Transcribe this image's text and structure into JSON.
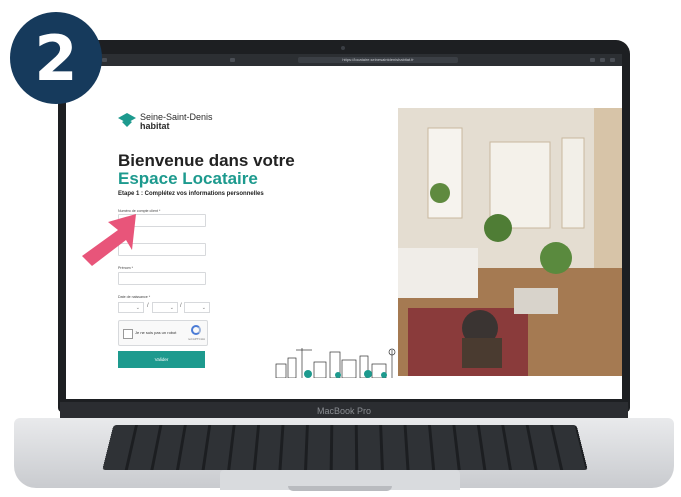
{
  "badge": {
    "number": "2",
    "color": "#163a5c"
  },
  "browser": {
    "url": "https://locataire.seinesaintdenishabitat.fr"
  },
  "logo": {
    "line1": "Seine-Saint-Denis",
    "line2": "habitat",
    "color": "#1d9a8e"
  },
  "page": {
    "title_line1": "Bienvenue dans votre",
    "title_line2": "Espace Locataire",
    "step": "Etape 1 : Complétez vos informations personnelles"
  },
  "form": {
    "client_number_label": "Numéro de compte client *",
    "lastname_label": "Nom *",
    "firstname_label": "Prénom *",
    "birthdate_label": "Date de naissance *",
    "date_sep": "/",
    "day_placeholder": "⌄",
    "month_placeholder": "⌄",
    "year_placeholder": "⌄",
    "captcha_text": "Je ne suis pas un robot",
    "captcha_brand": "reCAPTCHA",
    "submit_label": "Valider"
  },
  "laptop": {
    "brand": "MacBook Pro"
  },
  "colors": {
    "accent": "#1d9a8e",
    "arrow": "#e8557a"
  }
}
